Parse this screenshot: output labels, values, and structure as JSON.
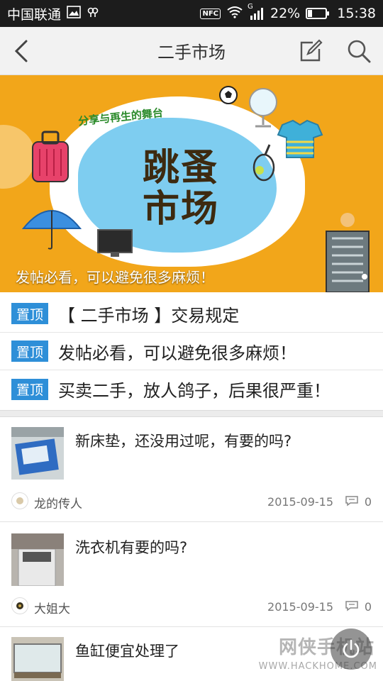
{
  "status_bar": {
    "carrier": "中国联通",
    "battery_percent": "22%",
    "battery_level": 0.22,
    "time": "15:38",
    "nfc_label": "NFC",
    "signal_label": "G"
  },
  "header": {
    "title": "二手市场"
  },
  "banner": {
    "headline_top": "跳蚤",
    "headline_bottom": "市场",
    "subtitle": "分享与再生的舞台",
    "caption": "发帖必看，可以避免很多麻烦！"
  },
  "sticky_badge": "置顶",
  "sticky_posts": [
    {
      "title": "【 二手市场 】交易规定"
    },
    {
      "title": "发帖必看，可以避免很多麻烦！"
    },
    {
      "title": "买卖二手，放人鸽子，后果很严重！"
    }
  ],
  "posts": [
    {
      "title": "新床垫，还没用过呢，有要的吗?",
      "author": "龙的传人",
      "date": "2015-09-15",
      "comments": "0"
    },
    {
      "title": "洗衣机有要的吗?",
      "author": "大姐大",
      "date": "2015-09-15",
      "comments": "0"
    },
    {
      "title": "鱼缸便宜处理了",
      "author": "",
      "date": "",
      "comments": ""
    }
  ],
  "watermark": {
    "text": "网侠手机站",
    "url": "WWW.HACKHOME.COM"
  },
  "colors": {
    "badge": "#2e8fd8",
    "banner_bg": "#f2a61a",
    "status_bar": "#1c1c1c"
  }
}
